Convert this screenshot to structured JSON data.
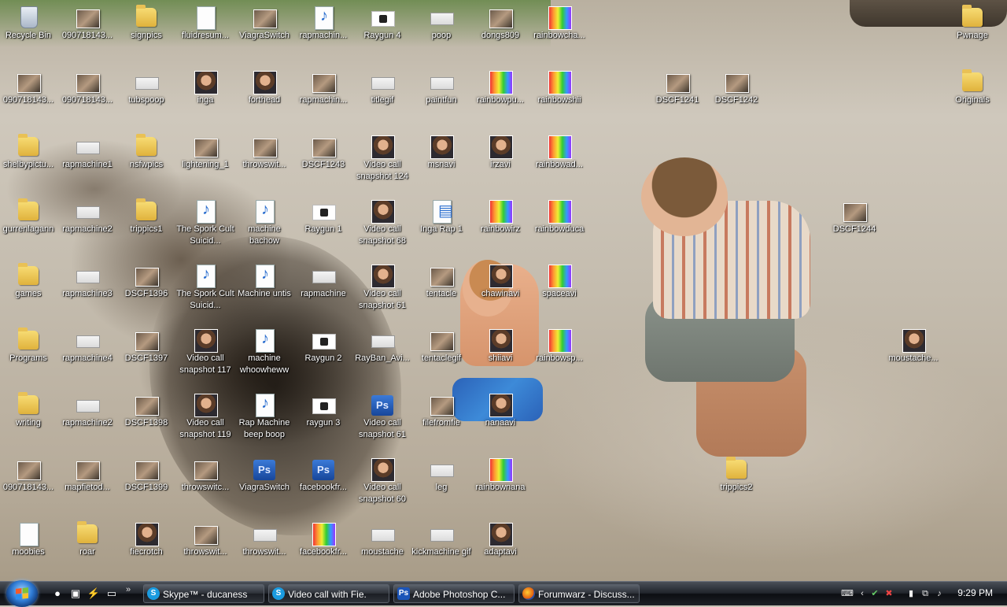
{
  "desktop": {
    "icons": [
      {
        "label": "Recycle Bin",
        "kind": "recycle"
      },
      {
        "label": "090718143...",
        "kind": "thumb"
      },
      {
        "label": "signpics",
        "kind": "folder"
      },
      {
        "label": "fluidresum...",
        "kind": "doc"
      },
      {
        "label": "ViagraSwitch",
        "kind": "thumb"
      },
      {
        "label": "rapmachin...",
        "kind": "wma"
      },
      {
        "label": "Raygun 4",
        "kind": "shadow"
      },
      {
        "label": "poop",
        "kind": "wide"
      },
      {
        "label": "dongs809",
        "kind": "thumb"
      },
      {
        "label": "rainbowcha...",
        "kind": "rainbow"
      },
      {
        "label": "Pwnage",
        "kind": "folder"
      },
      {
        "label": "090718143...",
        "kind": "thumb"
      },
      {
        "label": "090718143...",
        "kind": "thumb"
      },
      {
        "label": "tubspoop",
        "kind": "wide"
      },
      {
        "label": "inga",
        "kind": "portrait"
      },
      {
        "label": "forthead",
        "kind": "portrait"
      },
      {
        "label": "rapmachin...",
        "kind": "thumb"
      },
      {
        "label": "titlegif",
        "kind": "wide"
      },
      {
        "label": "paintfun",
        "kind": "wide"
      },
      {
        "label": "rainbowpu...",
        "kind": "rainbow"
      },
      {
        "label": "rainbowshii",
        "kind": "rainbow"
      },
      {
        "label": "DSCF1241",
        "kind": "thumb"
      },
      {
        "label": "DSCF1242",
        "kind": "thumb"
      },
      {
        "label": "Originals",
        "kind": "folder"
      },
      {
        "label": "shelbypictu...",
        "kind": "folder"
      },
      {
        "label": "rapmachine1",
        "kind": "wide"
      },
      {
        "label": "nsfwpics",
        "kind": "folder"
      },
      {
        "label": "lightening_1",
        "kind": "thumb"
      },
      {
        "label": "throwswit...",
        "kind": "thumb"
      },
      {
        "label": "DSCF1243",
        "kind": "thumb"
      },
      {
        "label": "Video call snapshot 124",
        "kind": "portrait"
      },
      {
        "label": "msnavi",
        "kind": "portrait"
      },
      {
        "label": "irzavi",
        "kind": "portrait"
      },
      {
        "label": "rainbowad...",
        "kind": "rainbow"
      },
      {
        "label": "gurrenlagann",
        "kind": "folder"
      },
      {
        "label": "rapmachine2",
        "kind": "wide"
      },
      {
        "label": "trippics1",
        "kind": "folder"
      },
      {
        "label": "The Spork Cult Suicid...",
        "kind": "mp3"
      },
      {
        "label": "machine bachow",
        "kind": "wma"
      },
      {
        "label": "Raygun 1",
        "kind": "shadow"
      },
      {
        "label": "Video call snapshot 68",
        "kind": "portrait"
      },
      {
        "label": "Inga Rap 1",
        "kind": "wmv"
      },
      {
        "label": "rainbowirz",
        "kind": "rainbow"
      },
      {
        "label": "rainbowduca",
        "kind": "rainbow"
      },
      {
        "label": "DSCF1244",
        "kind": "thumb"
      },
      {
        "label": "games",
        "kind": "folder"
      },
      {
        "label": "rapmachine3",
        "kind": "wide"
      },
      {
        "label": "DSCF1396",
        "kind": "thumb"
      },
      {
        "label": "The Spork Cult Suicid...",
        "kind": "mp3"
      },
      {
        "label": "Machine untis",
        "kind": "wma"
      },
      {
        "label": "rapmachine",
        "kind": "wide"
      },
      {
        "label": "Video call snapshot 61",
        "kind": "portrait"
      },
      {
        "label": "tentacle",
        "kind": "thumb"
      },
      {
        "label": "chawinavi",
        "kind": "portrait"
      },
      {
        "label": "spaceavi",
        "kind": "rainbow"
      },
      {
        "label": "Programs",
        "kind": "folder"
      },
      {
        "label": "rapmachine4",
        "kind": "wide"
      },
      {
        "label": "DSCF1397",
        "kind": "thumb"
      },
      {
        "label": "Video call snapshot 117",
        "kind": "portrait"
      },
      {
        "label": "machine whoowheww",
        "kind": "wma"
      },
      {
        "label": "Raygun 2",
        "kind": "shadow"
      },
      {
        "label": "RayBan_Avi...",
        "kind": "wide"
      },
      {
        "label": "tentaclegif",
        "kind": "thumb"
      },
      {
        "label": "shiiavi",
        "kind": "portrait"
      },
      {
        "label": "rainbowsp...",
        "kind": "rainbow"
      },
      {
        "label": "moustache...",
        "kind": "portrait"
      },
      {
        "label": "writing",
        "kind": "folder"
      },
      {
        "label": "rapmachine2",
        "kind": "wide"
      },
      {
        "label": "DSCF1398",
        "kind": "thumb"
      },
      {
        "label": "Video call snapshot 119",
        "kind": "portrait"
      },
      {
        "label": "Rap Machine beep boop",
        "kind": "wma"
      },
      {
        "label": "raygun 3",
        "kind": "shadow"
      },
      {
        "label": "Video call snapshot 61",
        "kind": "psd"
      },
      {
        "label": "filefromfie",
        "kind": "thumb"
      },
      {
        "label": "nanaavi",
        "kind": "portrait"
      },
      {
        "label": "090718143...",
        "kind": "thumb"
      },
      {
        "label": "mapfietod...",
        "kind": "thumb"
      },
      {
        "label": "DSCF1399",
        "kind": "thumb"
      },
      {
        "label": "throwswitc...",
        "kind": "thumb"
      },
      {
        "label": "ViagraSwitch",
        "kind": "psd"
      },
      {
        "label": "facebookfr...",
        "kind": "psd"
      },
      {
        "label": "Video call snapshot 60",
        "kind": "portrait"
      },
      {
        "label": "leg",
        "kind": "wide"
      },
      {
        "label": "rainbownana",
        "kind": "rainbow"
      },
      {
        "label": "trippics2",
        "kind": "folder"
      },
      {
        "label": "moobies",
        "kind": "doc"
      },
      {
        "label": "roar",
        "kind": "folder"
      },
      {
        "label": "fiecrotch",
        "kind": "portrait"
      },
      {
        "label": "throwswit...",
        "kind": "thumb"
      },
      {
        "label": "throwswit...",
        "kind": "wide"
      },
      {
        "label": "facebookfr...",
        "kind": "rainbow"
      },
      {
        "label": "moustache",
        "kind": "wide"
      },
      {
        "label": "kickmachine gif",
        "kind": "wide"
      },
      {
        "label": "adaptavi",
        "kind": "portrait"
      }
    ]
  },
  "taskbar": {
    "start_label": "Start",
    "quicklaunch": [
      {
        "icon": "firefox-icon"
      },
      {
        "icon": "explorer-icon"
      },
      {
        "icon": "winamp-icon"
      },
      {
        "icon": "show-desktop-icon"
      }
    ],
    "quicklaunch_more": "»",
    "tasks": [
      {
        "label": "Skype™ - ducaness",
        "icon": "skype-icon",
        "glyph": "S"
      },
      {
        "label": "Video call with Fie.",
        "icon": "skype-icon",
        "glyph": "S"
      },
      {
        "label": "Adobe Photoshop C...",
        "icon": "photoshop-icon",
        "glyph": "Ps"
      },
      {
        "label": "Forumwarz - Discuss...",
        "icon": "firefox-icon",
        "glyph": ""
      }
    ],
    "tray_expand": "‹",
    "clock": "9:29 PM"
  },
  "colors": {
    "label_text": "#ffffff",
    "taskbar_dark": "#0c0e12",
    "folder": "#e9c155",
    "photoshop": "#1c55b8",
    "skype": "#1a9be0"
  }
}
